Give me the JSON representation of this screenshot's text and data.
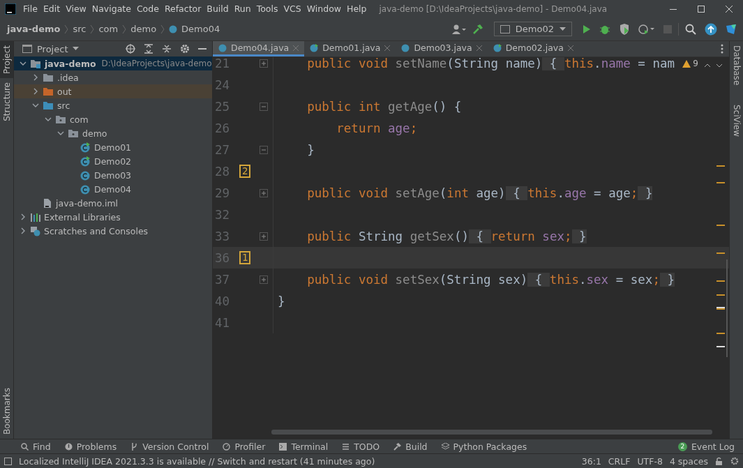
{
  "window": {
    "title": "java-demo [D:\\IdeaProjects\\java-demo] - Demo04.java"
  },
  "menu": [
    "File",
    "Edit",
    "View",
    "Navigate",
    "Code",
    "Refactor",
    "Build",
    "Run",
    "Tools",
    "VCS",
    "Window",
    "Help"
  ],
  "breadcrumbs": [
    "java-demo",
    "src",
    "com",
    "demo",
    "Demo04"
  ],
  "run_config": "Demo02",
  "left_strip": [
    {
      "label": "Project",
      "selected": true
    },
    {
      "label": "Structure",
      "selected": false
    },
    {
      "label": "Bookmarks",
      "selected": false
    }
  ],
  "right_strip": [
    "Database",
    "SciView"
  ],
  "project_panel": {
    "title": "Project",
    "tree": [
      {
        "label": "java-demo",
        "hint": "D:\\IdeaProjects\\java-demo",
        "kind": "module",
        "expanded": true,
        "selected": true,
        "hovered": false,
        "children": [
          {
            "label": ".idea",
            "kind": "folder",
            "expanded": false,
            "selected": false,
            "hovered": false
          },
          {
            "label": "out",
            "kind": "excluded",
            "expanded": false,
            "selected": false,
            "hovered": true
          },
          {
            "label": "src",
            "kind": "source",
            "expanded": true,
            "selected": false,
            "hovered": false,
            "children": [
              {
                "label": "com",
                "kind": "package",
                "expanded": true,
                "selected": false,
                "hovered": false,
                "children": [
                  {
                    "label": "demo",
                    "kind": "package",
                    "expanded": true,
                    "selected": false,
                    "hovered": false,
                    "children": [
                      {
                        "label": "Demo01",
                        "kind": "runclass",
                        "selected": false,
                        "hovered": false
                      },
                      {
                        "label": "Demo02",
                        "kind": "runclass",
                        "selected": false,
                        "hovered": false
                      },
                      {
                        "label": "Demo03",
                        "kind": "class",
                        "selected": false,
                        "hovered": false
                      },
                      {
                        "label": "Demo04",
                        "kind": "class",
                        "selected": false,
                        "hovered": false
                      }
                    ]
                  }
                ]
              }
            ]
          },
          {
            "label": "java-demo.iml",
            "kind": "file",
            "selected": false,
            "hovered": false
          }
        ]
      },
      {
        "label": "External Libraries",
        "kind": "libraries",
        "expanded": false,
        "selected": false,
        "hovered": false
      },
      {
        "label": "Scratches and Consoles",
        "kind": "scratches",
        "expanded": false,
        "selected": false,
        "hovered": false
      }
    ]
  },
  "tabs": [
    {
      "label": "Demo04.java",
      "selected": true,
      "runnable": false
    },
    {
      "label": "Demo01.java",
      "selected": false,
      "runnable": true
    },
    {
      "label": "Demo03.java",
      "selected": false,
      "runnable": false
    },
    {
      "label": "Demo02.java",
      "selected": false,
      "runnable": true
    }
  ],
  "editor": {
    "warnings": "9",
    "lines": [
      {
        "num": "21",
        "foldable": true,
        "folded": true,
        "current": false,
        "tokens": [
          {
            "t": "    public void ",
            "kind": "keyword"
          },
          {
            "t": "setName",
            "kind": "unused"
          },
          {
            "t": "(String name)",
            "kind": "plain"
          },
          {
            "t": " { ",
            "kind": "folded"
          },
          {
            "t": "this",
            "kind": "keyword"
          },
          {
            "t": ".",
            "kind": "plain"
          },
          {
            "t": "name",
            "kind": "field"
          },
          {
            "t": " = nam",
            "kind": "plain"
          }
        ]
      },
      {
        "num": "24",
        "current": false
      },
      {
        "num": "25",
        "foldable": true,
        "folded": false,
        "current": false,
        "tokens": [
          {
            "t": "    public int ",
            "kind": "keyword"
          },
          {
            "t": "getAge",
            "kind": "unused"
          },
          {
            "t": "() {",
            "kind": "plain"
          }
        ]
      },
      {
        "num": "26",
        "current": false,
        "tokens": [
          {
            "t": "        return ",
            "kind": "keyword"
          },
          {
            "t": "age",
            "kind": "field"
          },
          {
            "t": ";",
            "kind": "keyword"
          }
        ]
      },
      {
        "num": "27",
        "foldable": true,
        "folded": false,
        "current": false,
        "tokens": [
          {
            "t": "    }",
            "kind": "plain"
          }
        ]
      },
      {
        "num": "28",
        "bookmark": "2",
        "current": false
      },
      {
        "num": "29",
        "foldable": true,
        "folded": true,
        "current": false,
        "tokens": [
          {
            "t": "    public void ",
            "kind": "keyword"
          },
          {
            "t": "setAge",
            "kind": "unused"
          },
          {
            "t": "(",
            "kind": "plain"
          },
          {
            "t": "int ",
            "kind": "keyword"
          },
          {
            "t": "age)",
            "kind": "plain"
          },
          {
            "t": " { ",
            "kind": "folded"
          },
          {
            "t": "this",
            "kind": "keyword"
          },
          {
            "t": ".",
            "kind": "plain"
          },
          {
            "t": "age",
            "kind": "field"
          },
          {
            "t": " = age",
            "kind": "plain"
          },
          {
            "t": ";",
            "kind": "keyword"
          },
          {
            "t": " }",
            "kind": "folded"
          }
        ]
      },
      {
        "num": "32",
        "current": false
      },
      {
        "num": "33",
        "foldable": true,
        "folded": true,
        "current": false,
        "tokens": [
          {
            "t": "    public ",
            "kind": "keyword"
          },
          {
            "t": "String ",
            "kind": "plain"
          },
          {
            "t": "getSex",
            "kind": "unused"
          },
          {
            "t": "()",
            "kind": "plain"
          },
          {
            "t": " { ",
            "kind": "folded"
          },
          {
            "t": "return ",
            "kind": "keyword"
          },
          {
            "t": "sex",
            "kind": "field"
          },
          {
            "t": ";",
            "kind": "keyword"
          },
          {
            "t": " }",
            "kind": "folded"
          }
        ]
      },
      {
        "num": "36",
        "bookmark": "1",
        "current": true
      },
      {
        "num": "37",
        "foldable": true,
        "folded": true,
        "current": false,
        "tokens": [
          {
            "t": "    public void ",
            "kind": "keyword"
          },
          {
            "t": "setSex",
            "kind": "unused"
          },
          {
            "t": "(String sex)",
            "kind": "plain"
          },
          {
            "t": " { ",
            "kind": "folded"
          },
          {
            "t": "this",
            "kind": "keyword"
          },
          {
            "t": ".",
            "kind": "plain"
          },
          {
            "t": "sex",
            "kind": "field"
          },
          {
            "t": " = sex",
            "kind": "plain"
          },
          {
            "t": ";",
            "kind": "keyword"
          },
          {
            "t": " }",
            "kind": "folded"
          }
        ]
      },
      {
        "num": "40",
        "current": false,
        "tokens": [
          {
            "t": "}",
            "kind": "plain"
          }
        ]
      },
      {
        "num": "41",
        "current": false
      }
    ]
  },
  "tool_windows": [
    {
      "label": "Find",
      "kind": "search"
    },
    {
      "label": "Problems",
      "kind": "problems"
    },
    {
      "label": "Version Control",
      "kind": "vcs"
    },
    {
      "label": "Profiler",
      "kind": "profiler"
    },
    {
      "label": "Terminal",
      "kind": "terminal"
    },
    {
      "label": "TODO",
      "kind": "list"
    },
    {
      "label": "Build",
      "kind": "build"
    },
    {
      "label": "Python Packages",
      "kind": "packages"
    }
  ],
  "event_log": {
    "label": "Event Log",
    "count": "2"
  },
  "status_bar": {
    "message": "Localized IntelliJ IDEA 2021.3.3 is available // Switch and restart (41 minutes ago)",
    "position": "36:1",
    "line_separator": "CRLF",
    "encoding": "UTF-8",
    "indent": "4 spaces"
  }
}
